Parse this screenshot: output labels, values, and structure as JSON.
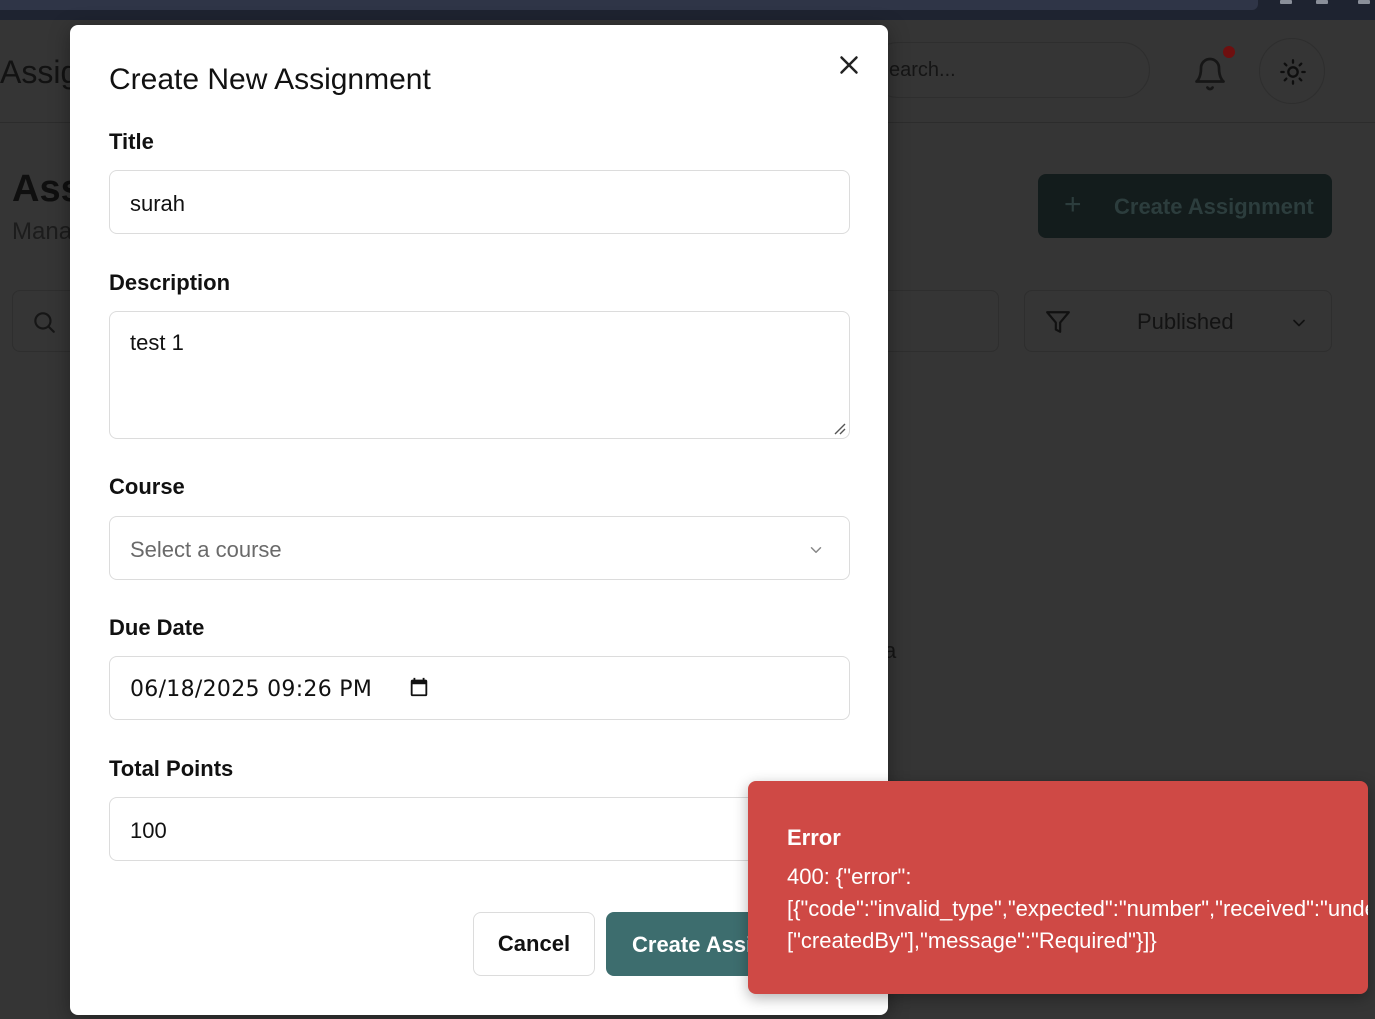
{
  "background": {
    "app_title": "Assig",
    "search_placeholder": "earch...",
    "page_title": "Ass",
    "page_subtitle": "Mana",
    "create_button_label": "Create Assignment",
    "filter_value": "Published",
    "fragment_text": "a"
  },
  "modal": {
    "title": "Create New Assignment",
    "fields": {
      "title": {
        "label": "Title",
        "value": "surah"
      },
      "description": {
        "label": "Description",
        "value": "test 1"
      },
      "course": {
        "label": "Course",
        "placeholder": "Select a course"
      },
      "due_date": {
        "label": "Due Date",
        "value": "06/18/2025 09:26 PM"
      },
      "total_points": {
        "label": "Total Points",
        "value": "100"
      }
    },
    "buttons": {
      "cancel": "Cancel",
      "submit": "Create Assignment"
    }
  },
  "toast": {
    "title": "Error",
    "lines": [
      "400: {\"error\":",
      "[{\"code\":\"invalid_type\",\"expected\":\"number\",\"received\":\"undefined\",\"path\":",
      "[\"createdBy\"],\"message\":\"Required\"}]}"
    ]
  },
  "colors": {
    "overlay": "#353535",
    "primary": "#3d6d6e",
    "error": "#cf4945",
    "notification_dot": "#6e0f0f"
  },
  "icons": [
    "close-icon",
    "chevron-down-icon",
    "calendar-icon",
    "resize-handle-icon",
    "bell-icon",
    "sun-icon",
    "search-icon",
    "filter-icon",
    "plus-icon"
  ]
}
